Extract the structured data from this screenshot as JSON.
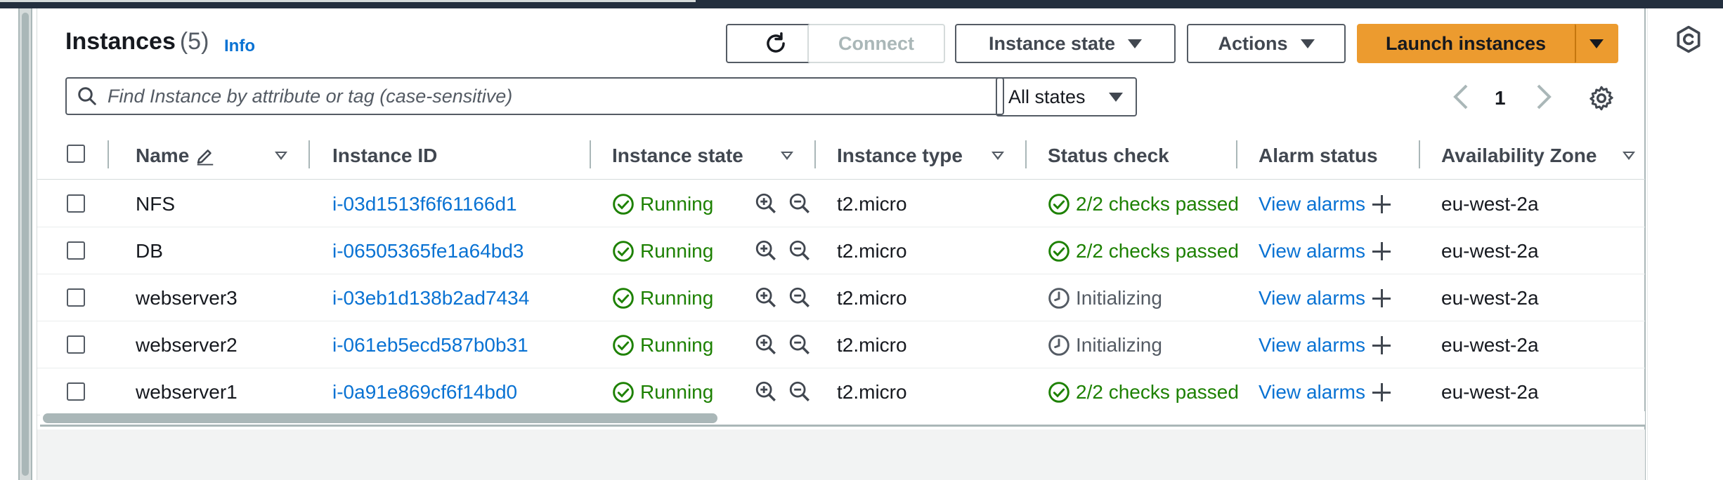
{
  "header": {
    "title": "Instances",
    "count": "(5)",
    "info_link": "Info"
  },
  "toolbar": {
    "connect_label": "Connect",
    "instance_state_label": "Instance state",
    "actions_label": "Actions",
    "launch_label": "Launch instances"
  },
  "search": {
    "placeholder": "Find Instance by attribute or tag (case-sensitive)"
  },
  "filter": {
    "selected": "All states"
  },
  "pagination": {
    "current_page": "1"
  },
  "columns": [
    "Name",
    "Instance ID",
    "Instance state",
    "Instance type",
    "Status check",
    "Alarm status",
    "Availability Zone"
  ],
  "rows": [
    {
      "name": "NFS",
      "id": "i-03d1513f6f61166d1",
      "state": "Running",
      "type": "t2.micro",
      "status": "2/2 checks passed",
      "alarm": "View alarms",
      "az": "eu-west-2a"
    },
    {
      "name": "DB",
      "id": "i-06505365fe1a64bd3",
      "state": "Running",
      "type": "t2.micro",
      "status": "2/2 checks passed",
      "alarm": "View alarms",
      "az": "eu-west-2a"
    },
    {
      "name": "webserver3",
      "id": "i-03eb1d138b2ad7434",
      "state": "Running",
      "type": "t2.micro",
      "status": "Initializing",
      "alarm": "View alarms",
      "az": "eu-west-2a"
    },
    {
      "name": "webserver2",
      "id": "i-061eb5ecd587b0b31",
      "state": "Running",
      "type": "t2.micro",
      "status": "Initializing",
      "alarm": "View alarms",
      "az": "eu-west-2a"
    },
    {
      "name": "webserver1",
      "id": "i-0a91e869cf6f14bd0",
      "state": "Running",
      "type": "t2.micro",
      "status": "2/2 checks passed",
      "alarm": "View alarms",
      "az": "eu-west-2a"
    }
  ],
  "colors": {
    "link": "#0972d3",
    "success": "#1d8102",
    "primary_button": "#ec9b2f",
    "pending": "#545b64"
  },
  "icons": [
    "refresh-icon",
    "search-icon",
    "chevron-left-icon",
    "chevron-right-icon",
    "gear-icon",
    "edit-icon",
    "check-circle-icon",
    "clock-icon",
    "zoom-in-icon",
    "zoom-out-icon",
    "plus-icon"
  ]
}
